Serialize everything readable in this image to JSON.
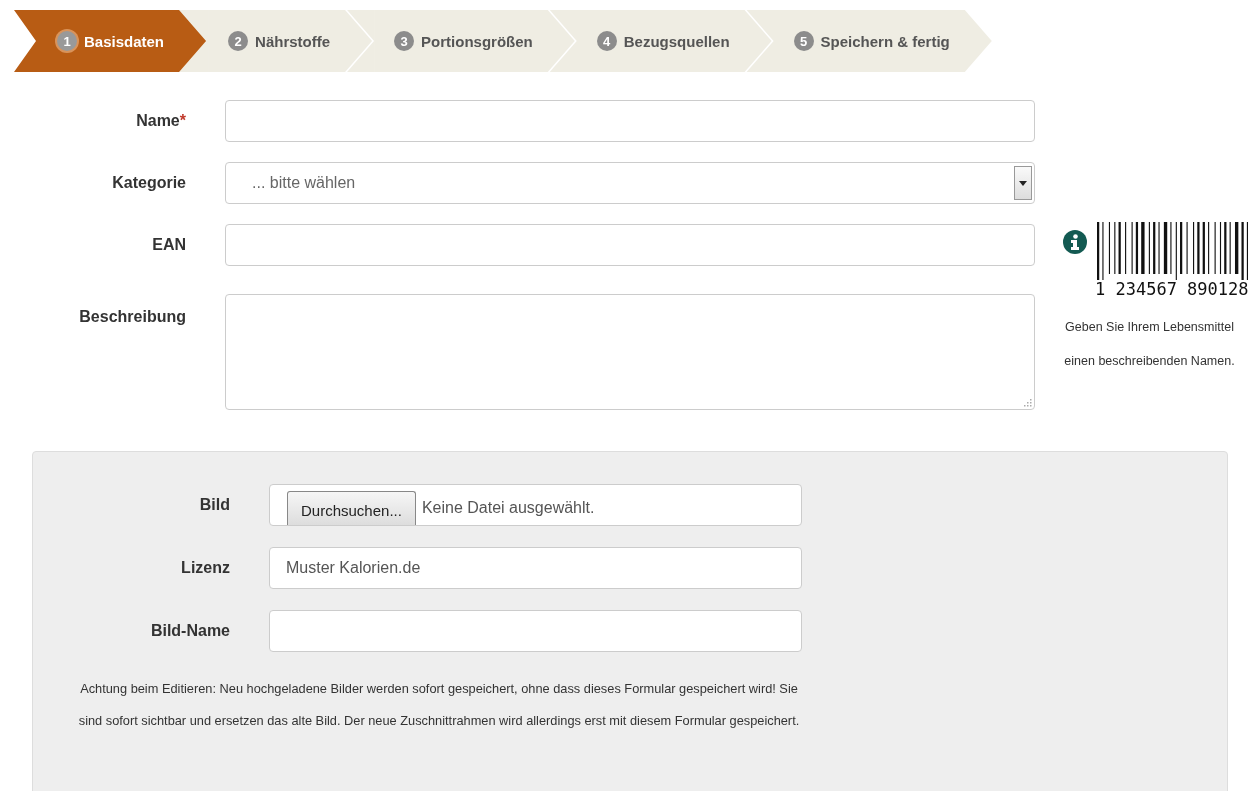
{
  "steps": [
    {
      "number": "1",
      "label": "Basisdaten",
      "selected": true
    },
    {
      "number": "2",
      "label": "Nährstoffe",
      "selected": false
    },
    {
      "number": "3",
      "label": "Portionsgrößen",
      "selected": false
    },
    {
      "number": "4",
      "label": "Bezugsquellen",
      "selected": false
    },
    {
      "number": "5",
      "label": "Speichern & fertig",
      "selected": false
    }
  ],
  "fields": [
    {
      "kind": "text",
      "label": "Name",
      "required_mark": "*"
    },
    {
      "kind": "select",
      "label": "Kategorie",
      "value": "... bitte wählen"
    },
    {
      "kind": "text",
      "label": "EAN"
    },
    {
      "kind": "textarea",
      "label": "Beschreibung"
    }
  ],
  "sidebar": {
    "barcode_number": "1 234567 890128",
    "help": [
      "Geben Sie Ihrem Lebensmittel",
      "einen beschreibenden Namen."
    ]
  },
  "image_panel": {
    "fields": [
      {
        "kind": "file",
        "label": "Bild",
        "button": "Durchsuchen...",
        "status": "Keine Datei ausgewählt."
      },
      {
        "kind": "text",
        "label": "Lizenz",
        "value": "Muster Kalorien.de"
      },
      {
        "kind": "text",
        "label": "Bild-Name"
      }
    ],
    "note": "Achtung beim Editieren: Neu hochgeladene Bilder werden sofort gespeichert, ohne dass dieses Formular gespeichert wird! Sie sind sofort sichtbar und ersetzen das alte Bild. Der neue Zuschnittrahmen wird allerdings erst mit diesem Formular gespeichert."
  }
}
